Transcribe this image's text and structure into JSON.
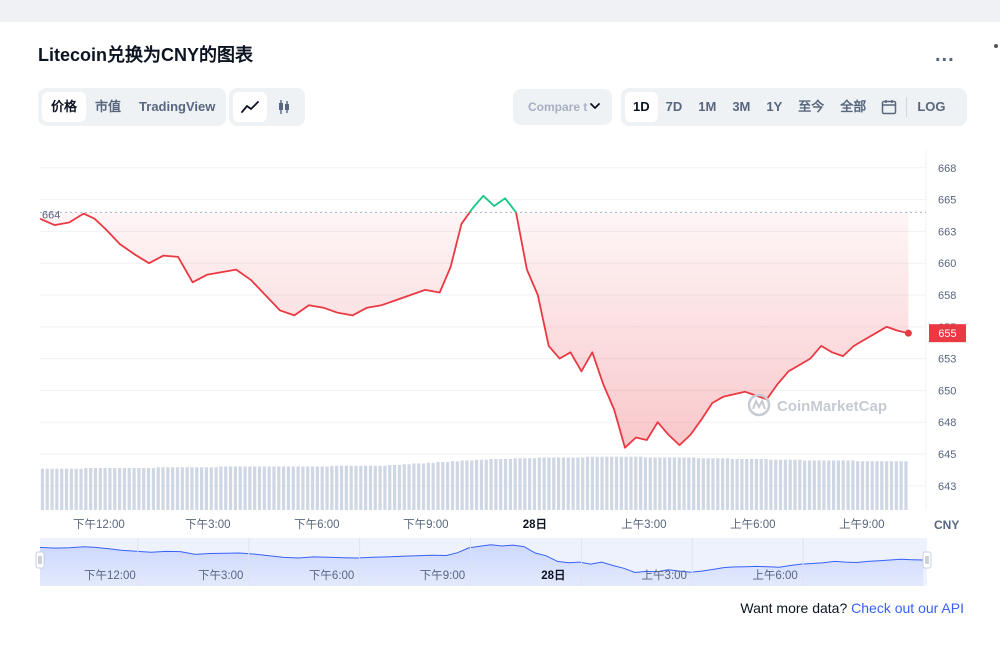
{
  "page": {
    "title": "Litecoin兑换为CNY的图表",
    "more_label": "...",
    "tabs": [
      {
        "label": "价格",
        "active": true
      },
      {
        "label": "市值",
        "active": false
      },
      {
        "label": "TradingView",
        "active": false
      }
    ],
    "chart_types": [
      {
        "icon": "line-chart-icon",
        "active": true
      },
      {
        "icon": "candlestick-icon",
        "active": false
      }
    ],
    "compare_placeholder": "Compare t",
    "ranges": [
      {
        "label": "1D",
        "active": true
      },
      {
        "label": "7D",
        "active": false
      },
      {
        "label": "1M",
        "active": false
      },
      {
        "label": "3M",
        "active": false
      },
      {
        "label": "1Y",
        "active": false
      },
      {
        "label": "至今",
        "active": false
      },
      {
        "label": "全部",
        "active": false
      }
    ],
    "calendar_icon": "calendar-icon",
    "log_label": "LOG",
    "footer_text": "Want more data?",
    "footer_link": "Check out our API",
    "watermark": "CoinMarketCap",
    "colors": {
      "up": "#16c784",
      "down": "#ea3943",
      "axis_text": "#58667e",
      "grid": "#eff2f5",
      "volume": "#cfd6e4",
      "nav_line": "#3861fb"
    }
  },
  "chart_data": {
    "type": "line",
    "currency": "CNY",
    "open_price": 664.5,
    "open_price_label": "664",
    "current_price": 655,
    "current_price_label": "655",
    "y_ticks": [
      {
        "label": "668",
        "value": 668
      },
      {
        "label": "665",
        "value": 665.5
      },
      {
        "label": "663",
        "value": 663
      },
      {
        "label": "660",
        "value": 660.5
      },
      {
        "label": "658",
        "value": 658
      },
      {
        "label": "655",
        "value": 655.5
      },
      {
        "label": "653",
        "value": 653
      },
      {
        "label": "650",
        "value": 650.5
      },
      {
        "label": "648",
        "value": 648
      },
      {
        "label": "645",
        "value": 645.5
      },
      {
        "label": "643",
        "value": 643
      }
    ],
    "ylim": [
      641.1,
      669.4
    ],
    "xlim": [
      0,
      24
    ],
    "x_ticks": [
      {
        "label": "下午12:00",
        "x": 1.62,
        "bold": false
      },
      {
        "label": "下午3:00",
        "x": 4.62,
        "bold": false
      },
      {
        "label": "下午6:00",
        "x": 7.62,
        "bold": false
      },
      {
        "label": "下午9:00",
        "x": 10.62,
        "bold": false
      },
      {
        "label": "28日",
        "x": 13.62,
        "bold": true
      },
      {
        "label": "上午3:00",
        "x": 16.62,
        "bold": false
      },
      {
        "label": "上午6:00",
        "x": 19.62,
        "bold": false
      },
      {
        "label": "上午9:00",
        "x": 22.62,
        "bold": false
      }
    ],
    "x": [
      0,
      0.4,
      0.8,
      1.2,
      1.5,
      1.8,
      2.2,
      2.6,
      3.0,
      3.4,
      3.8,
      4.2,
      4.6,
      5.0,
      5.4,
      5.8,
      6.2,
      6.6,
      7.0,
      7.4,
      7.8,
      8.2,
      8.6,
      9.0,
      9.4,
      9.8,
      10.2,
      10.6,
      11.0,
      11.3,
      11.6,
      11.9,
      12.2,
      12.5,
      12.8,
      13.1,
      13.4,
      13.7,
      14.0,
      14.3,
      14.6,
      14.9,
      15.2,
      15.5,
      15.8,
      16.1,
      16.4,
      16.7,
      17.0,
      17.3,
      17.6,
      17.9,
      18.2,
      18.5,
      18.8,
      19.1,
      19.4,
      19.7,
      20.0,
      20.3,
      20.6,
      20.9,
      21.2,
      21.5,
      21.8,
      22.1,
      22.4,
      22.7,
      23.0,
      23.3,
      23.6,
      23.9
    ],
    "y": [
      664.0,
      663.5,
      663.7,
      664.4,
      664.0,
      663.2,
      662.0,
      661.2,
      660.5,
      661.1,
      661.0,
      659.0,
      659.6,
      659.8,
      660.0,
      659.2,
      658.0,
      656.8,
      656.4,
      657.2,
      657.0,
      656.6,
      656.4,
      657.0,
      657.2,
      657.6,
      658.0,
      658.4,
      658.2,
      660.2,
      663.6,
      664.8,
      665.8,
      665.0,
      665.6,
      664.5,
      660.0,
      658.0,
      654.0,
      653.0,
      653.5,
      652.0,
      653.5,
      651.0,
      649.0,
      646.0,
      646.8,
      646.6,
      648.0,
      647.0,
      646.2,
      647.0,
      648.2,
      649.5,
      650.0,
      650.2,
      650.4,
      650.1,
      649.8,
      651.0,
      652.0,
      652.5,
      653.0,
      654.0,
      653.5,
      653.2,
      654.0,
      654.5,
      655.0,
      655.5,
      655.2,
      655.0
    ],
    "volume": [
      0.55,
      0.55,
      0.55,
      0.55,
      0.56,
      0.56,
      0.56,
      0.56,
      0.56,
      0.56,
      0.57,
      0.57,
      0.57,
      0.57,
      0.57,
      0.58,
      0.58,
      0.58,
      0.58,
      0.58,
      0.58,
      0.58,
      0.58,
      0.58,
      0.59,
      0.59,
      0.59,
      0.59,
      0.59,
      0.6,
      0.61,
      0.62,
      0.63,
      0.64,
      0.65,
      0.66,
      0.67,
      0.68,
      0.68,
      0.69,
      0.69,
      0.7,
      0.7,
      0.7,
      0.7,
      0.71,
      0.71,
      0.71,
      0.71,
      0.71,
      0.7,
      0.7,
      0.7,
      0.7,
      0.69,
      0.69,
      0.69,
      0.68,
      0.68,
      0.68,
      0.67,
      0.67,
      0.67,
      0.66,
      0.66,
      0.66,
      0.66,
      0.65,
      0.65,
      0.65,
      0.65,
      0.65
    ],
    "navigator_ticks": [
      {
        "label": "下午12:00",
        "x": 1.62,
        "bold": false
      },
      {
        "label": "下午3:00",
        "x": 4.62,
        "bold": false
      },
      {
        "label": "下午6:00",
        "x": 7.62,
        "bold": false
      },
      {
        "label": "下午9:00",
        "x": 10.62,
        "bold": false
      },
      {
        "label": "28日",
        "x": 13.62,
        "bold": true
      },
      {
        "label": "上午3:00",
        "x": 16.62,
        "bold": false
      },
      {
        "label": "上午6:00",
        "x": 19.62,
        "bold": false
      }
    ],
    "grid": true
  }
}
